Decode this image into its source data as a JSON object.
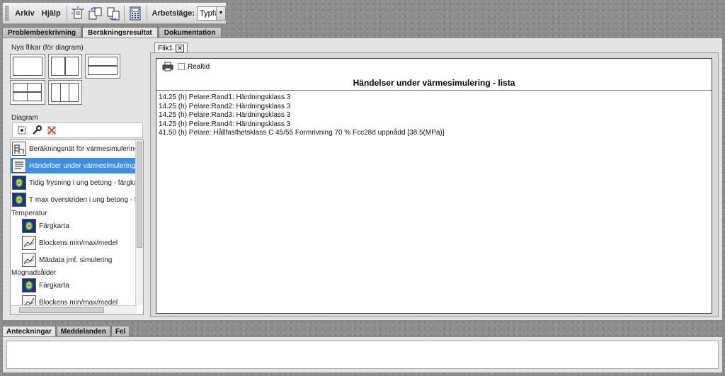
{
  "menu": {
    "file": "Arkiv",
    "help": "Hjälp"
  },
  "toolbar": {
    "mode_label": "Arbetsläge:",
    "mode_value": "Typfall"
  },
  "main_tabs": [
    "Problembeskrivning",
    "Beräkningsresultat",
    "Dokumentation"
  ],
  "left_panel": {
    "new_tabs_label": "Nya flikar (för diagram)",
    "diagram_label": "Diagram",
    "items": [
      {
        "label": "Beräkningsnät för värmesimulering",
        "icon": "mesh-icon"
      },
      {
        "label": "Händelser under värmesimulering - lista",
        "icon": "list-doc-icon",
        "selected": true
      },
      {
        "label": "Tidig frysning i ung betong - färgkarta",
        "icon": "colormap-icon"
      },
      {
        "label": "T max överskriden i ung betong - färgkarta",
        "icon": "colormap-icon"
      }
    ],
    "categories": [
      {
        "name": "Temperatur",
        "items": [
          "Färgkarta",
          "Blockens min/max/medel",
          "Mätdata jmf. simulering"
        ]
      },
      {
        "name": "Mognadsålder",
        "items": [
          "Färgkarta",
          "Blockens min/max/medel"
        ]
      }
    ]
  },
  "document": {
    "tab_label": "Flik1",
    "realtime_label": "Realtid",
    "title": "Händelser under värmesimulering - lista",
    "events": [
      "14.25 (h) Pelare:Rand1: Härdningsklass 3",
      "14.25 (h) Pelare:Rand2: Härdningsklass 3",
      "14.25 (h) Pelare:Rand3: Härdningsklass 3",
      "14.25 (h) Pelare:Rand4: Härdningsklass 3",
      "41.50 (h) Pelare: Hållfasthetsklass C 45/55 Formrivning 70 % Fcc28d uppnådd [38.5(MPa)]"
    ]
  },
  "bottom_tabs": [
    "Anteckningar",
    "Meddelanden",
    "Fel"
  ],
  "colors": {
    "selection": "#3d8ee0",
    "panel": "#e4e4e4"
  }
}
